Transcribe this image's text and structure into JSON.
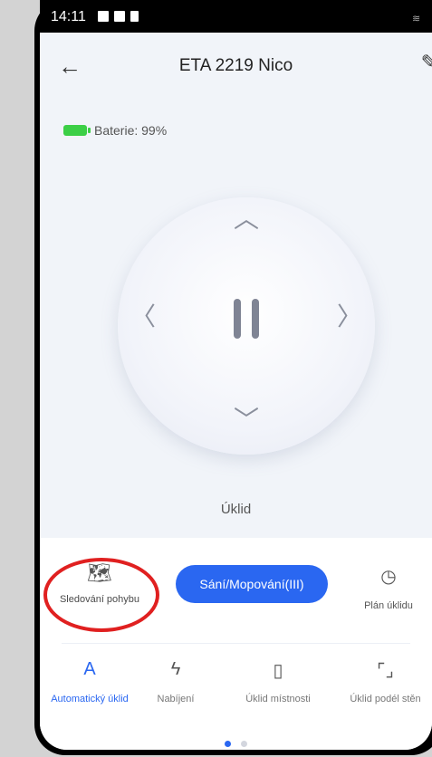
{
  "status_bar": {
    "time": "14:11"
  },
  "header": {
    "back_icon": "←",
    "title": "ETA 2219 Nico",
    "edit_icon": "✎"
  },
  "battery": {
    "label": "Baterie: 99%",
    "level": 0.99,
    "color": "#3ccf46"
  },
  "joystick": {
    "up_icon": "︿",
    "down_icon": "﹀",
    "left_icon": "〈",
    "right_icon": "〉"
  },
  "mode_label": "Úklid",
  "controls": {
    "follow_icon": "🗺",
    "follow_label": "Sledování pohybu",
    "suction_label": "Sání/Mopování(III)",
    "plan_icon": "◷",
    "plan_label": "Plán úklidu"
  },
  "modes": [
    {
      "icon": "A",
      "label": "Automatický úklid",
      "active": true
    },
    {
      "icon": "ϟ",
      "label": "Nabíjení",
      "active": false
    },
    {
      "icon": "▯",
      "label": "Úklid místnosti",
      "active": false
    },
    {
      "icon": "⌜⌟",
      "label": "Úklid podél stěn",
      "active": false
    }
  ],
  "pager": {
    "pages": 2,
    "current": 1
  },
  "colors": {
    "accent": "#2a67f1",
    "highlight": "#e02020"
  }
}
